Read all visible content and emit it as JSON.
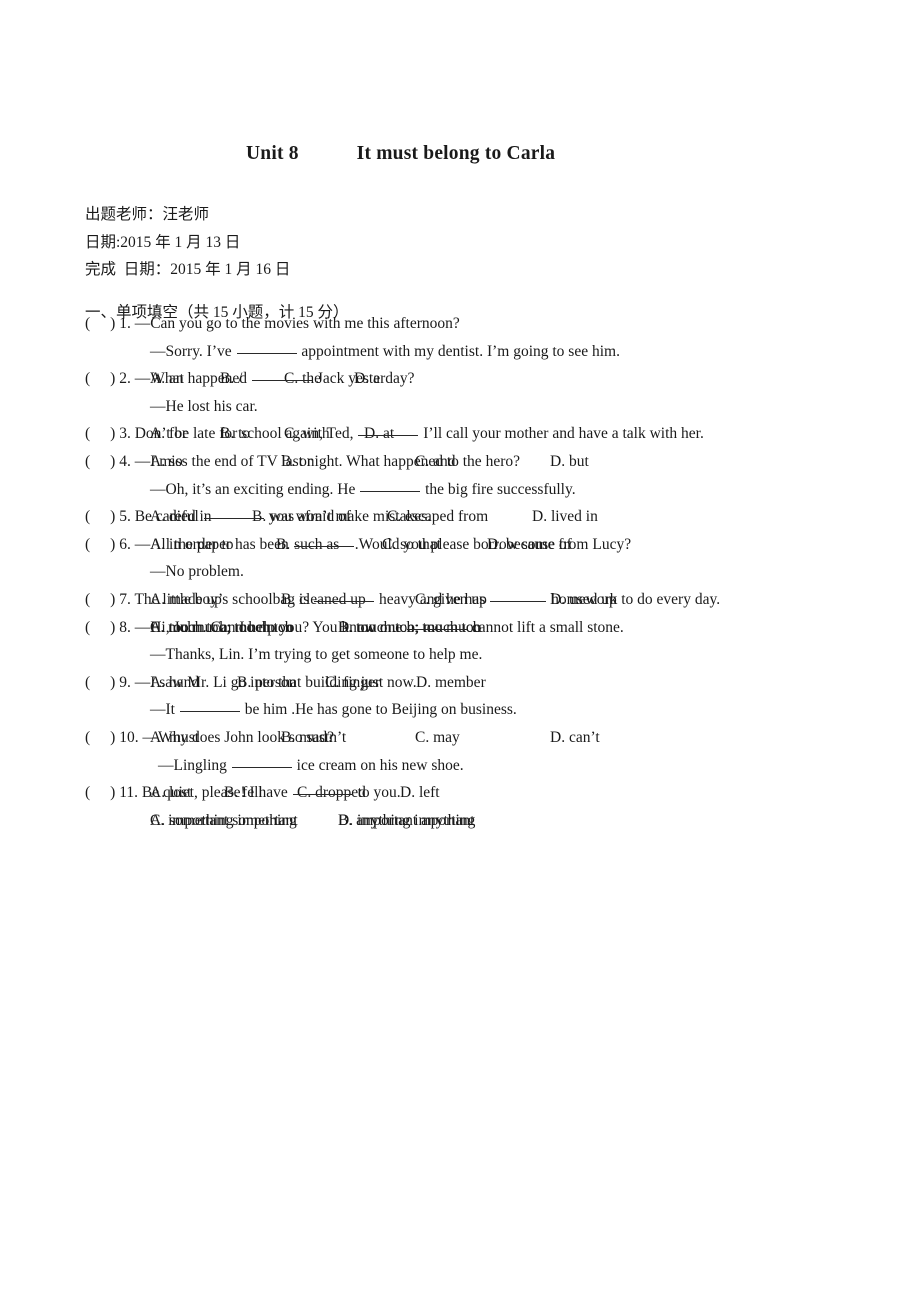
{
  "document": {
    "title_unit": "Unit 8",
    "title_main": "It must belong to Carla",
    "meta": [
      "出题老师：汪老师",
      "日期:2015 年 1 月 13 日",
      "完成  日期：2015 年 1 月 16 日"
    ],
    "section_heading": "一、单项填空（共 15 小题，计 15 分）",
    "questions": [
      {
        "number": "1.",
        "lines": [
          "—Can you go to the movies with me this afternoon?"
        ],
        "blank_line_pre": "—Sorry. I’ve ",
        "blank_line_post": " appointment with my dentist. I’m going to see him.",
        "options": [
          "A. an",
          "B. /",
          "C. the",
          "D. a"
        ],
        "option_layout": "tight",
        "option_x": [
          0,
          70,
          134,
          204
        ]
      },
      {
        "number": "2.",
        "blank_line_pre": "—What happened ",
        "blank_line_post": " Jack yesterday?",
        "second_line": "—He lost his car.",
        "options": [
          "A. for",
          "B. to",
          "C. with",
          "D. at"
        ],
        "option_layout": "tight",
        "option_x": [
          0,
          70,
          134,
          214
        ]
      },
      {
        "number": "3.",
        "blank_line_pre": "Don’t be late for school again, Ted, ",
        "blank_line_post": " I’ll call your mother and have a talk with her.",
        "options": [
          "A. so",
          "B. or",
          "C. and",
          "D. but"
        ],
        "option_layout": "wide",
        "option_x": [
          0,
          131,
          265,
          400
        ]
      },
      {
        "number": "4.",
        "lines": [
          "—I miss the end of TV last night. What happened to the hero?"
        ],
        "blank_line_pre": "—Oh, it’s an exciting ending. He ",
        "blank_line_post": " the big fire successfully.",
        "options": [
          "A. died in",
          "B. was afraid of",
          "C. escaped from",
          "D. lived in"
        ],
        "option_layout": "tight",
        "option_x": [
          0,
          102,
          237,
          382
        ]
      },
      {
        "number": "5.",
        "blank_line_pre": "Be careful ",
        "blank_line_post": " you won’t make mistakes.",
        "options": [
          "A. in order to",
          "B. such as",
          "C. so that",
          "D. because of"
        ],
        "option_layout": "tight",
        "option_x": [
          0,
          126,
          232,
          337
        ]
      },
      {
        "number": "6.",
        "blank_line_pre": "—All the paper has been ",
        "blank_line_post": ".Would you please borrow some from Lucy?",
        "second_line": "—No problem.",
        "options": [
          "A. made up",
          "B. cleaned up",
          "C. given up",
          "D. used up"
        ],
        "option_layout": "wide",
        "option_x": [
          0,
          131,
          265,
          400
        ]
      },
      {
        "number": "7.",
        "blank_line_pre": "The little boy’s schoolbag is ",
        "blank_line_mid": " heavy and he has ",
        "blank_line_post": " homework to do every day.",
        "options": [
          "A. too much; much too",
          "B. too much; too much",
          "C. much too; too much",
          "D. much too; much too"
        ],
        "option_layout": "grid2",
        "option_x": [
          0,
          188
        ]
      },
      {
        "number": "8.",
        "blank_line_pre": "—Hi, John. Can I help you? You know one ",
        "blank_line_post": " cannot lift a small stone.",
        "second_line": "—Thanks, Lin. I’m trying to get someone to help me.",
        "options": [
          "A. hand",
          "B. person",
          "C. finger",
          "D. member"
        ],
        "option_layout": "tight",
        "option_x": [
          0,
          87,
          175,
          266
        ]
      },
      {
        "number": "9.",
        "lines": [
          "—I saw Mr. Li go into that building just now."
        ],
        "blank_line_pre": "—It ",
        "blank_line_post": " be him .He has gone to Beijing on business.",
        "options": [
          "A. must",
          "B. mustn’t",
          "C. may",
          "D. can’t"
        ],
        "option_layout": "wide",
        "option_x": [
          0,
          131,
          265,
          400
        ]
      },
      {
        "number": "10.",
        "lines": [
          "—Why does John look so sad?"
        ],
        "blank_line_pre": "—Lingling ",
        "blank_line_post": " ice cream on his new shoe.",
        "options": [
          "A. lost",
          "B. fell",
          "C. dropped",
          "D. left"
        ],
        "option_layout": "tight",
        "option_x": [
          0,
          74,
          147,
          250
        ]
      },
      {
        "number": "11.",
        "blank_line_pre": "Be quiet, please! I have ",
        "blank_line_post": " to you.",
        "options": [
          "A. something important",
          "B. anything important",
          "C. important something",
          "D. important anything"
        ],
        "option_layout": "grid2",
        "option_x": [
          0,
          188
        ]
      }
    ]
  }
}
